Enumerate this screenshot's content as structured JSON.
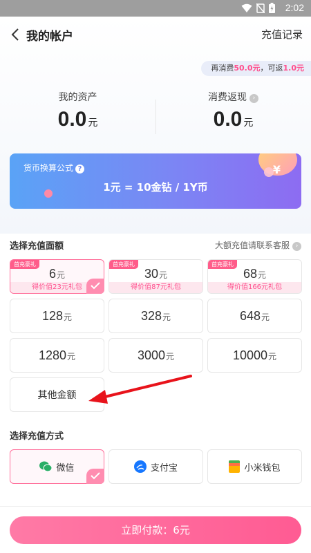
{
  "status_bar": {
    "time": "2:02"
  },
  "nav": {
    "title": "我的帐户",
    "records": "充值记录"
  },
  "rebate": {
    "prefix": "再消费",
    "amount": "50.0元",
    "mid": "，可返",
    "back": "1.0元"
  },
  "assets": {
    "my_assets_label": "我的资产",
    "my_assets_value": "0.0",
    "unit": "元",
    "cashback_label": "消费返现",
    "cashback_value": "0.0"
  },
  "banner": {
    "label": "货币换算公式",
    "formula": "1元 = 10金钻 / 1Y币",
    "coin": "¥"
  },
  "amount_section": {
    "title": "选择充值面额",
    "note": "大额充值请联系客服"
  },
  "amounts": [
    {
      "value": "6",
      "unit": "元",
      "tag": "首充豪礼",
      "gift": "得价值23元礼包"
    },
    {
      "value": "30",
      "unit": "元",
      "tag": "首充豪礼",
      "gift": "得价值87元礼包"
    },
    {
      "value": "68",
      "unit": "元",
      "tag": "首充豪礼",
      "gift": "得价值166元礼包"
    },
    {
      "value": "128",
      "unit": "元"
    },
    {
      "value": "328",
      "unit": "元"
    },
    {
      "value": "648",
      "unit": "元"
    },
    {
      "value": "1280",
      "unit": "元"
    },
    {
      "value": "3000",
      "unit": "元"
    },
    {
      "value": "10000",
      "unit": "元"
    }
  ],
  "other_amount": "其他金额",
  "pay_section": {
    "title": "选择充值方式"
  },
  "pay_methods": [
    {
      "label": "微信",
      "icon": "wechat-icon",
      "color": "#2aae67"
    },
    {
      "label": "支付宝",
      "icon": "alipay-icon",
      "color": "#1677ff"
    },
    {
      "label": "小米钱包",
      "icon": "mi-wallet-icon",
      "color": "#ffb300"
    }
  ],
  "pay_button": "立即付款：6元",
  "colors": {
    "accent": "#ff5b93",
    "banner_start": "#5aa3f6",
    "banner_end": "#8d6cf2",
    "annotation_arrow": "#e8131b"
  }
}
